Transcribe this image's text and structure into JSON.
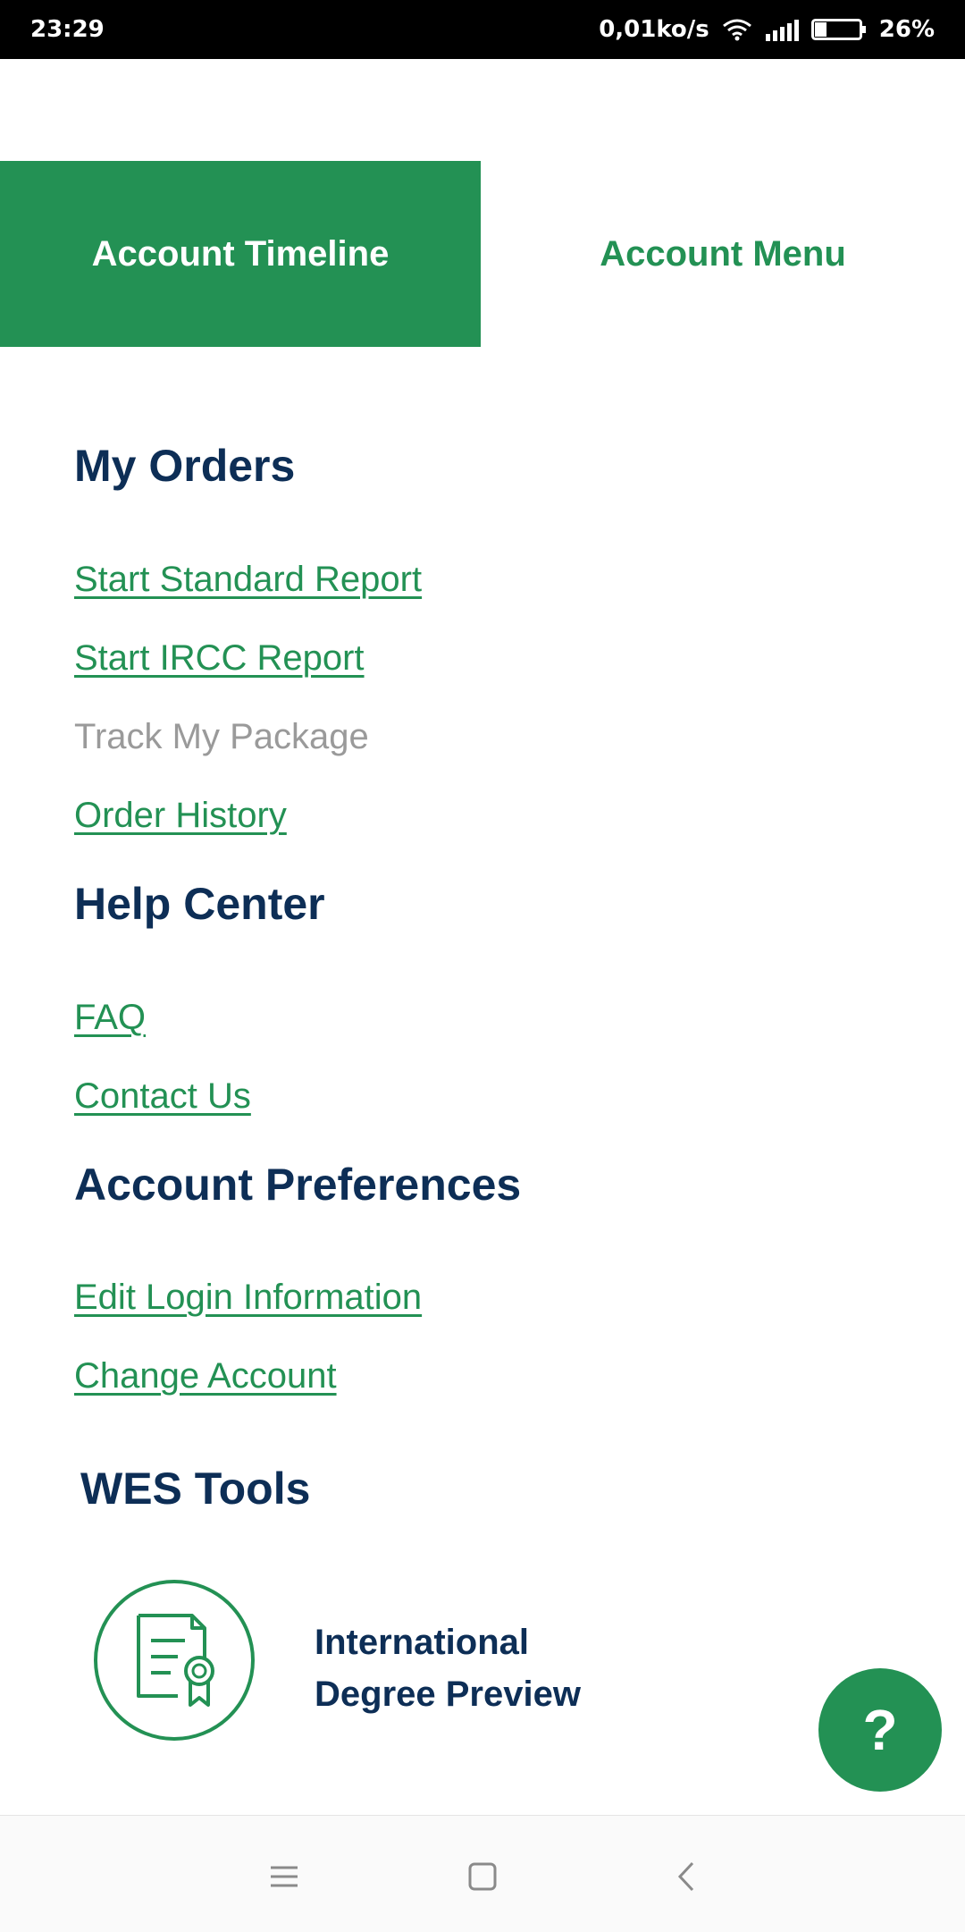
{
  "status_bar": {
    "time": "23:29",
    "speed": "0,01ko/s",
    "battery_percent": "26%",
    "battery_level": 0.26
  },
  "tabs": [
    {
      "label": "Account Timeline",
      "active": true
    },
    {
      "label": "Account Menu",
      "active": false
    }
  ],
  "sections": {
    "orders": {
      "heading": "My Orders",
      "links": [
        "Start Standard Report",
        "Start IRCC Report",
        "Track My Package",
        "Order History"
      ]
    },
    "help": {
      "heading": "Help Center",
      "links": [
        "FAQ",
        "Contact Us"
      ]
    },
    "preferences": {
      "heading": "Account Preferences",
      "links": [
        "Edit Login Information",
        "Change Account"
      ]
    },
    "tools": {
      "heading": "WES Tools",
      "items": [
        {
          "line1": "International",
          "line2": "Degree Preview",
          "icon": "certificate-icon"
        }
      ]
    }
  },
  "help_button": {
    "label": "?"
  },
  "colors": {
    "brand_green": "#239154",
    "heading_navy": "#0d2e56",
    "disabled_gray": "#9a9a9a"
  }
}
